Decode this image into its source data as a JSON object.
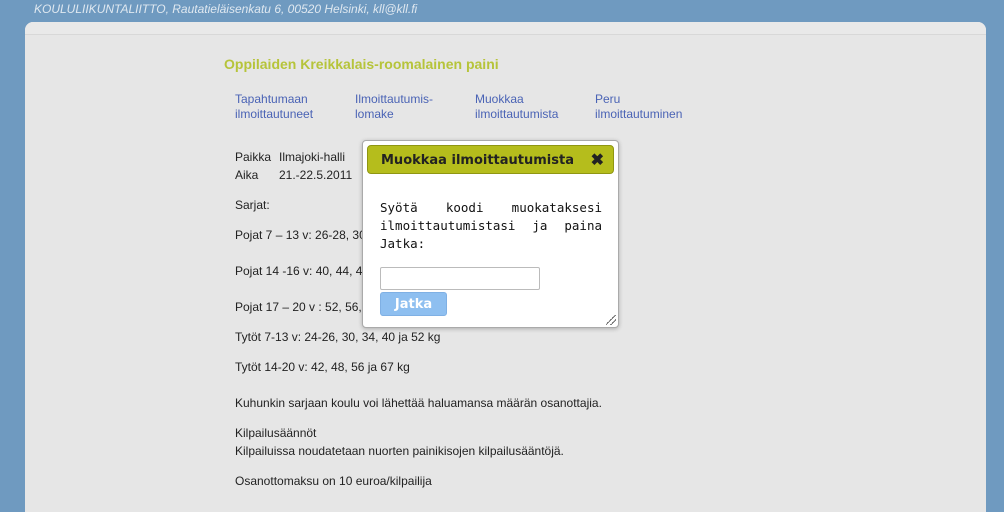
{
  "header": {
    "address_line": "KOULULIIKUNTALIITTO, Rautatieläisenkatu 6, 00520 Helsinki, kll@kll.fi"
  },
  "page": {
    "title": "Oppilaiden Kreikkalais-roomalainen paini"
  },
  "nav": [
    {
      "line1": "Tapahtumaan",
      "line2": "ilmoittautuneet"
    },
    {
      "line1": "Ilmoittautumis-",
      "line2": "lomake"
    },
    {
      "line1": "Muokkaa",
      "line2": "ilmoittautumista"
    },
    {
      "line1": "Peru",
      "line2": "ilmoittautuminen"
    }
  ],
  "info": {
    "place_label": "Paikka",
    "place_value": "Ilmajoki-halli",
    "time_label": "Aika",
    "time_value": "21.-22.5.2011"
  },
  "content": {
    "series_heading": "Sarjat:",
    "series": [
      "Pojat 7 – 13 v: 26-28, 30",
      "Pojat 14 -16 v: 40, 44, 4",
      "Pojat 17 – 20 v : 52, 56,",
      "Tytöt 7-13 v: 24-26, 30, 34, 40 ja 52 kg",
      "Tytöt 14-20 v: 42, 48, 56 ja 67 kg"
    ],
    "participants_note": "Kuhunkin sarjaan koulu voi lähettää haluamansa määrän osanottajia.",
    "rules_heading": "Kilpailusäännöt",
    "rules_text": "Kilpailuissa noudatetaan nuorten painikisojen kilpailusääntöjä.",
    "fee_text": "Osanottomaksu on 10 euroa/kilpailija"
  },
  "dialog": {
    "title": "Muokkaa ilmoittautumista",
    "close_glyph": "✖",
    "instruction": "Syötä koodi muokataksesi ilmoittautumistasi ja paina Jatka:",
    "input_value": "",
    "button_label": "Jatka"
  },
  "colors": {
    "background": "#6f9ac0",
    "panel": "#e6e6e6",
    "title": "#b6c43a",
    "link": "#4a63b5",
    "dialog_header": "#b5bd1c",
    "button": "#8ebff0"
  }
}
